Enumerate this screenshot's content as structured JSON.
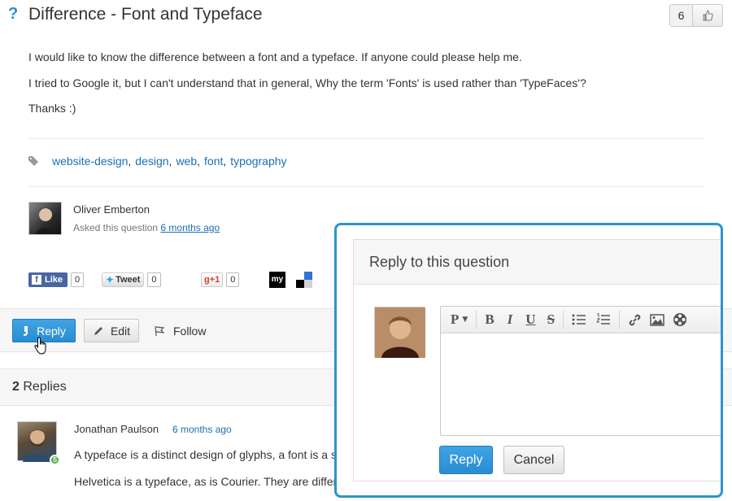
{
  "question": {
    "icon": "?",
    "title": "Difference - Font and Typeface",
    "vote_count": "6",
    "body": [
      "I would like to know the difference between a font and a typeface. If anyone could please help me.",
      "I tried to Google it, but I can't understand that in general, Why the term 'Fonts' is used rather than 'TypeFaces'?",
      "Thanks :)"
    ],
    "tags": [
      "website-design",
      "design",
      "web",
      "font",
      "typography"
    ],
    "author": "Oliver Emberton",
    "asked_prefix": "Asked this question",
    "asked_time": "6 months ago"
  },
  "share": {
    "fb_label": "Like",
    "fb_f": "f",
    "fb_count": "0",
    "tweet_label": "Tweet",
    "tweet_count": "0",
    "gplus_label": "g+1",
    "gplus_count": "0",
    "my_label": "my"
  },
  "actions": {
    "reply": "Reply",
    "edit": "Edit",
    "follow": "Follow"
  },
  "replies": {
    "count": "2",
    "label": "Replies",
    "first": {
      "author": "Jonathan Paulson",
      "time": "6 months ago",
      "badge": "S",
      "line1": "A typeface is a distinct design of glyphs, a font is a s",
      "line2": "Helvetica is a typeface, as is Courier. They are differ"
    }
  },
  "modal": {
    "title": "Reply to this question",
    "toolbar": {
      "paragraph": "P",
      "bold": "B",
      "italic": "I",
      "underline": "U",
      "strike": "S"
    },
    "reply_button": "Reply",
    "cancel_button": "Cancel"
  },
  "colors": {
    "link": "#1a6fb5",
    "primary": "#2a8fd6",
    "modal_border": "#2a96c9"
  }
}
